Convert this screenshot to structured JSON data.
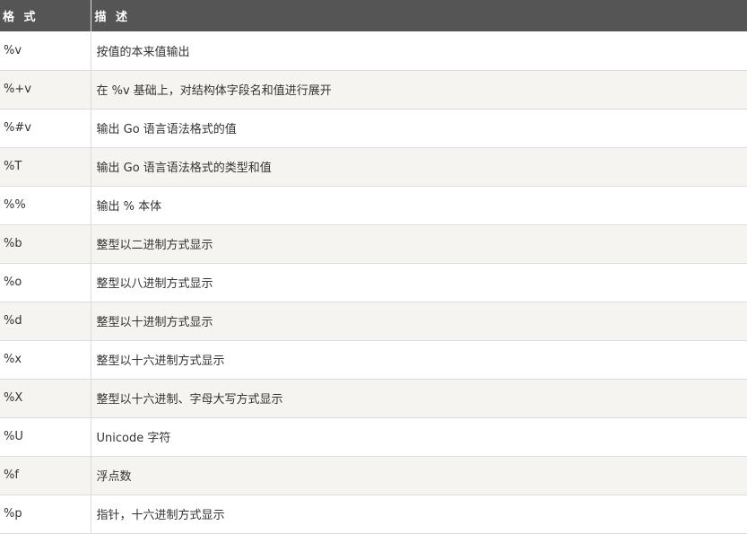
{
  "table": {
    "headers": [
      "格 式",
      "描 述"
    ],
    "rows": [
      {
        "format": "%v",
        "desc": "按值的本来值输出"
      },
      {
        "format": "%+v",
        "desc": "在 %v 基础上，对结构体字段名和值进行展开"
      },
      {
        "format": "%#v",
        "desc": "输出 Go 语言语法格式的值"
      },
      {
        "format": "%T",
        "desc": "输出 Go 语言语法格式的类型和值"
      },
      {
        "format": "%%",
        "desc": "输出 % 本体"
      },
      {
        "format": "%b",
        "desc": "整型以二进制方式显示"
      },
      {
        "format": "%o",
        "desc": "整型以八进制方式显示"
      },
      {
        "format": "%d",
        "desc": "整型以十进制方式显示"
      },
      {
        "format": "%x",
        "desc": "整型以十六进制方式显示"
      },
      {
        "format": "%X",
        "desc": "整型以十六进制、字母大写方式显示"
      },
      {
        "format": "%U",
        "desc": "Unicode 字符"
      },
      {
        "format": "%f",
        "desc": "浮点数"
      },
      {
        "format": "%p",
        "desc": "指针，十六进制方式显示"
      }
    ]
  },
  "colors": {
    "header_bg": "#555555",
    "header_text": "#ffffff",
    "row_alt_bg": "#f6f4f0",
    "border": "#dcdcdc"
  }
}
